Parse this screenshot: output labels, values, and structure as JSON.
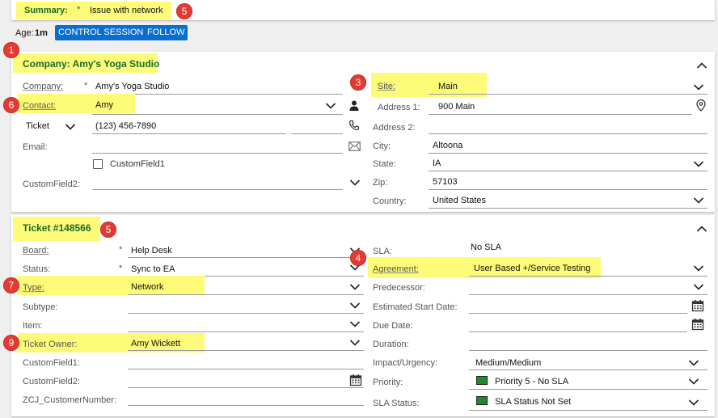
{
  "summary": {
    "label": "Summary:",
    "required": "*",
    "value": "Issue with network",
    "badge": "5"
  },
  "header": {
    "age_label": "Age:",
    "age_value": "1m",
    "control_button": "CONTROL SESSION",
    "follow_button": "FOLLOW"
  },
  "company": {
    "title": "Company: Amy's Yoga Studio",
    "badge_title": "1",
    "company_label": "Company:",
    "company_required": "*",
    "company_value": "Amy's Yoga Studio",
    "contact_label": "Contact:",
    "contact_value": "Amy",
    "badge_contact": "6",
    "phone_type": "Ticket",
    "phone_value": "(123) 456-7890",
    "email_label": "Email:",
    "customfield1_label": "CustomField1",
    "customfield2_label": "CustomField2:",
    "site_label": "Site:",
    "site_value": "Main",
    "badge_site": "3",
    "address1_label": "Address 1:",
    "address1_value": "900 Main",
    "address2_label": "Address 2:",
    "city_label": "City:",
    "city_value": "Altoona",
    "state_label": "State:",
    "state_value": "IA",
    "zip_label": "Zip:",
    "zip_value": "57103",
    "country_label": "Country:",
    "country_value": "United States"
  },
  "ticket": {
    "title": "Ticket #148566",
    "badge_title": "5",
    "board_label": "Board:",
    "board_required": "*",
    "board_value": "Help Desk",
    "status_label": "Status:",
    "status_required": "*",
    "status_value": "Sync to EA",
    "type_label": "Type:",
    "type_value": "Network",
    "badge_type": "7",
    "subtype_label": "Subtype:",
    "item_label": "Item:",
    "owner_label": "Ticket Owner:",
    "owner_value": "Amy Wickett",
    "badge_owner": "9",
    "customfield1_label": "CustomField1:",
    "customfield2_label": "CustomField2:",
    "zcj_label": "ZCJ_CustomerNumber:",
    "sla_label": "SLA:",
    "sla_value": "No SLA",
    "agreement_label": "Agreement:",
    "agreement_value": "User Based +/Service Testing",
    "badge_agreement": "4",
    "predecessor_label": "Predecessor:",
    "est_start_label": "Estimated Start Date:",
    "due_label": "Due Date:",
    "duration_label": "Duration:",
    "impact_label": "Impact/Urgency:",
    "impact_value": "Medium/Medium",
    "priority_label": "Priority:",
    "priority_value": "Priority 5 - No SLA",
    "sla_status_label": "SLA Status:",
    "sla_status_value": "SLA Status Not Set"
  },
  "colors": {
    "highlight": "#fdfb78",
    "badge": "#e23b33",
    "button": "#0a6ed1",
    "section_title": "#1a6b2a",
    "status_square": "#1e8a2e"
  }
}
